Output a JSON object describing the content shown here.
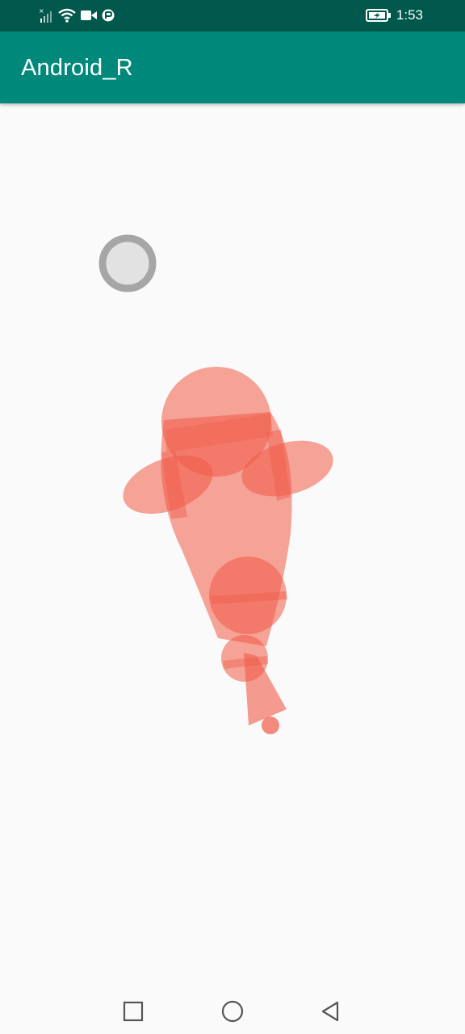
{
  "status_bar": {
    "time": "1:53",
    "icons": [
      "signal-icon",
      "wifi-icon",
      "video-call-icon",
      "notification-icon",
      "battery-charging-icon"
    ]
  },
  "app_bar": {
    "title": "Android_R"
  },
  "canvas": {
    "fish_color": "#f05a46",
    "target_ring_color": "#9e9e9e",
    "target_fill_color": "#e0e0e0"
  },
  "nav_bar": {
    "buttons": [
      "recents-square-icon",
      "home-circle-icon",
      "back-triangle-icon"
    ]
  }
}
